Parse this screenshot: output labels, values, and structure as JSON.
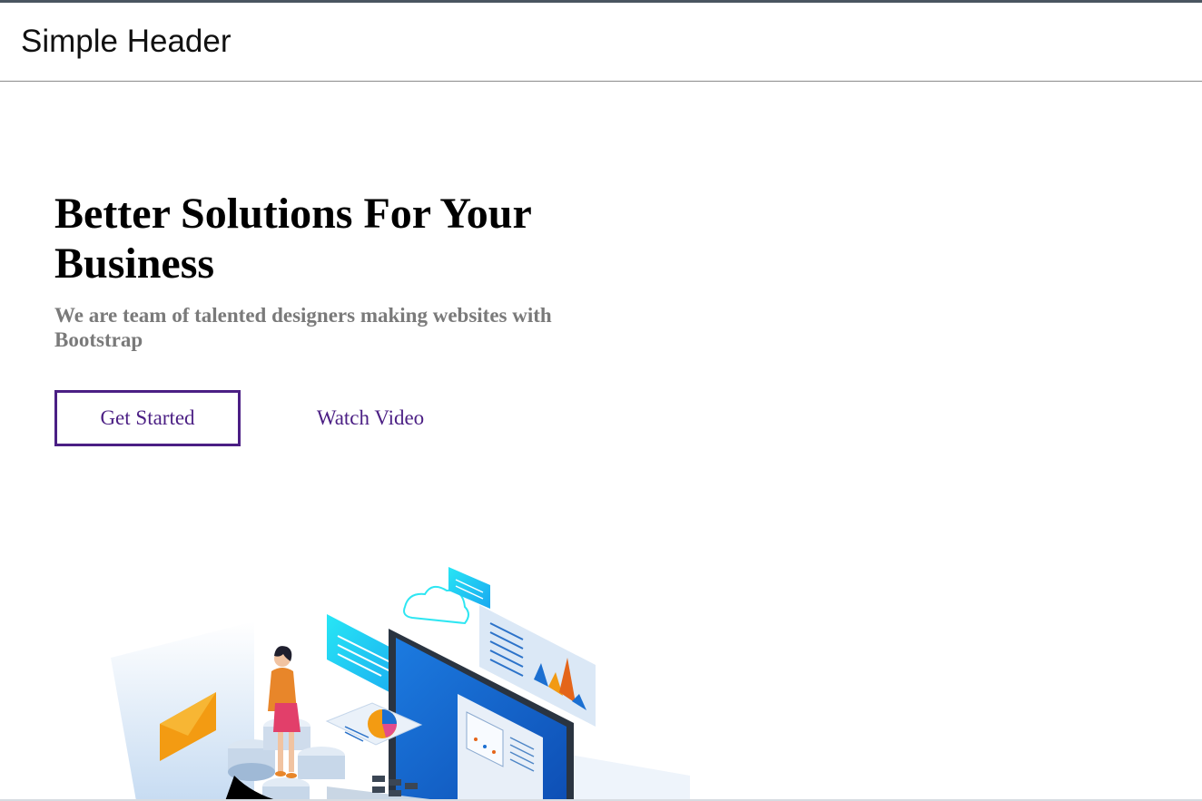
{
  "header": {
    "brand": "Simple Header"
  },
  "hero": {
    "title": "Better Solutions For Your Business",
    "subtitle": "We are team of talented designers making websites with Bootstrap",
    "primary_button": "Get Started",
    "secondary_button": "Watch Video"
  },
  "colors": {
    "accent": "#4b1f84",
    "subtitle": "#7a7a7a",
    "header_border": "#8c8c8c"
  },
  "illustration": {
    "icon": "business-isometric-illustration"
  }
}
